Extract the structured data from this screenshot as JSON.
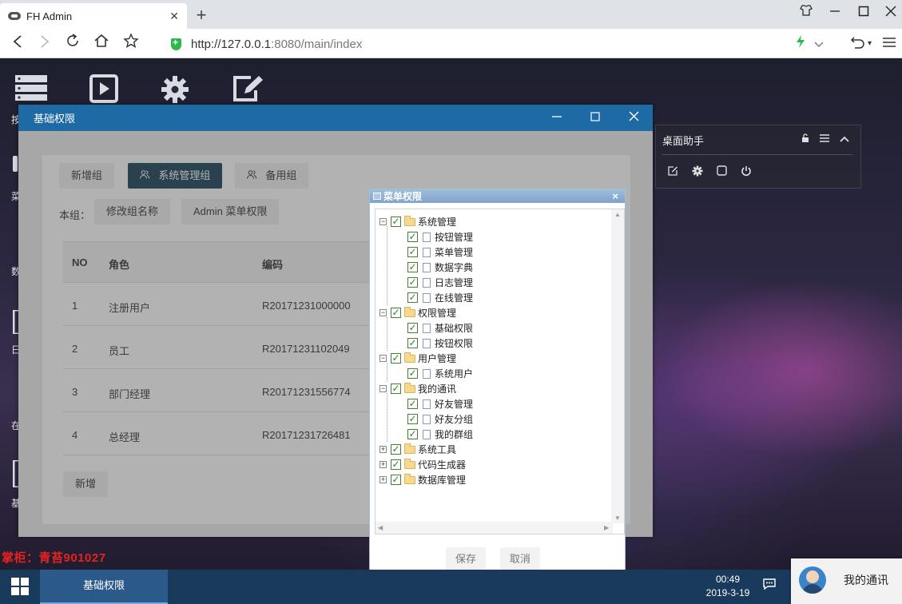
{
  "browser": {
    "tab_title": "FH Admin",
    "tab_close": "✕",
    "new_tab": "+",
    "url_host": "http://127.0.0.1",
    "url_path": ":8080/main/index"
  },
  "desktop": {
    "icon_labels": [
      "按",
      "菜",
      "数",
      "日",
      "在",
      "基"
    ],
    "watermark": "掌柜：青苔901027"
  },
  "main_window": {
    "title": "基础权限",
    "group_buttons": [
      "新增组",
      "系统管理组",
      "备用组"
    ],
    "this_group_label": "本组：",
    "action_buttons": [
      "修改组名称",
      "Admin 菜单权限"
    ],
    "table": {
      "columns": [
        "NO",
        "角色",
        "编码"
      ],
      "rows": [
        [
          "1",
          "注册用户",
          "R20171231000000"
        ],
        [
          "2",
          "员工",
          "R20171231102049"
        ],
        [
          "3",
          "部门经理",
          "R20171231556774"
        ],
        [
          "4",
          "总经理",
          "R20171231726481"
        ]
      ]
    },
    "add_button": "新增"
  },
  "assistant": {
    "title": "桌面助手"
  },
  "menu_dialog": {
    "title": "菜单权限",
    "close": "×",
    "tree": [
      {
        "label": "系统管理",
        "expanded": true,
        "children": [
          "按钮管理",
          "菜单管理",
          "数据字典",
          "日志管理",
          "在线管理"
        ]
      },
      {
        "label": "权限管理",
        "expanded": true,
        "children": [
          "基础权限",
          "按钮权限"
        ]
      },
      {
        "label": "用户管理",
        "expanded": true,
        "children": [
          "系统用户"
        ]
      },
      {
        "label": "我的通讯",
        "expanded": true,
        "children": [
          "好友管理",
          "好友分组",
          "我的群组"
        ]
      },
      {
        "label": "系统工具",
        "expanded": false,
        "children": []
      },
      {
        "label": "代码生成器",
        "expanded": false,
        "children": []
      },
      {
        "label": "数据库管理",
        "expanded": false,
        "children": []
      }
    ],
    "save_button": "保存",
    "cancel_button": "取消"
  },
  "taskbar": {
    "task_item": "基础权限",
    "time": "00:49",
    "date": "2019-3-19",
    "contacts_label": "我的通讯"
  }
}
